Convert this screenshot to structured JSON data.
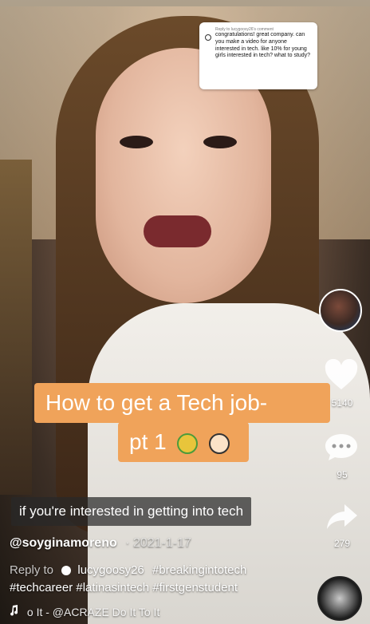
{
  "comment_card": {
    "reply_to": "Reply to lucygoosy26's comment",
    "text": "congratulations! great company. can you make a video for anyone interested in tech. like 10% for young girls interested in tech? what to study?"
  },
  "overlay_title": {
    "line1": "How to get a Tech job-",
    "line2": "pt 1"
  },
  "caption": "if you're interested in getting into tech",
  "post": {
    "username": "@soyginamoreno",
    "date": "· 2021-1-17",
    "reply_label": "Reply to",
    "reply_user": "lucygoosy26",
    "hashtags_line1": "#breakingintotech",
    "hashtags_line2": "#techcareer #latinasintech #firstgenstudent",
    "music_text": "o It - @ACRAZE    Do It To It"
  },
  "rail": {
    "likes": "5140",
    "comments": "95",
    "shares": "279"
  },
  "icons": [
    "comment-bubble-icon",
    "money-face-icon",
    "technologist-icon",
    "heart-icon",
    "comment-icon",
    "share-arrow-icon",
    "music-note-icon",
    "music-disc-icon"
  ]
}
